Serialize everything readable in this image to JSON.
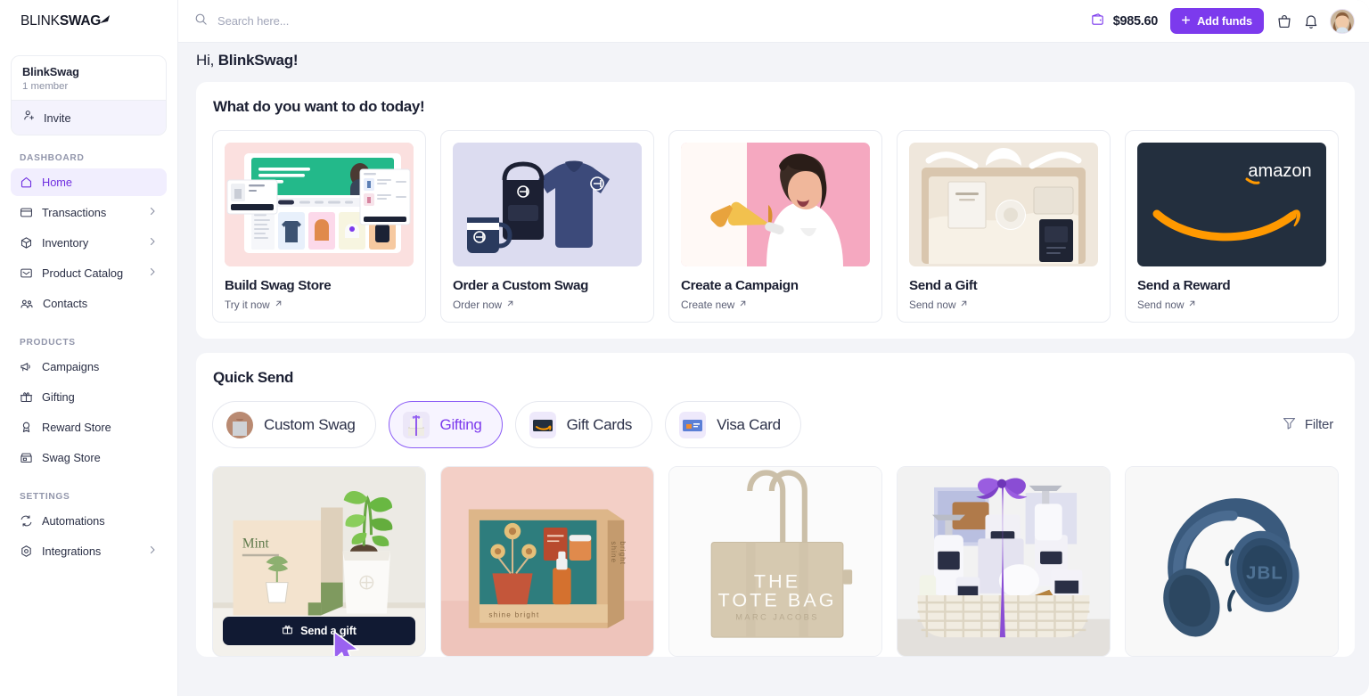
{
  "brand": {
    "name_light": "BLINK",
    "name_bold": "SWAG",
    "accent": "#7c3aed"
  },
  "topbar": {
    "search_placeholder": "Search here...",
    "search_value": "",
    "balance": "$985.60",
    "add_funds_label": "Add funds",
    "icons": [
      "wallet-icon",
      "bag-icon",
      "bell-icon",
      "avatar"
    ]
  },
  "sidebar": {
    "org": {
      "name": "BlinkSwag",
      "members": "1 member",
      "invite_label": "Invite"
    },
    "sections": [
      {
        "label": "DASHBOARD",
        "items": [
          {
            "label": "Home",
            "icon": "home-icon",
            "active": true,
            "chevron": false
          },
          {
            "label": "Transactions",
            "icon": "card-icon",
            "active": false,
            "chevron": true
          },
          {
            "label": "Inventory",
            "icon": "box-icon",
            "active": false,
            "chevron": true
          },
          {
            "label": "Product Catalog",
            "icon": "catalog-icon",
            "active": false,
            "chevron": true
          },
          {
            "label": "Contacts",
            "icon": "contacts-icon",
            "active": false,
            "chevron": false
          }
        ]
      },
      {
        "label": "PRODUCTS",
        "items": [
          {
            "label": "Campaigns",
            "icon": "megaphone-icon",
            "active": false,
            "chevron": false
          },
          {
            "label": "Gifting",
            "icon": "gift-icon",
            "active": false,
            "chevron": false
          },
          {
            "label": "Reward Store",
            "icon": "medal-icon",
            "active": false,
            "chevron": false
          },
          {
            "label": "Swag Store",
            "icon": "store-icon",
            "active": false,
            "chevron": false
          }
        ]
      },
      {
        "label": "SETTINGS",
        "items": [
          {
            "label": "Automations",
            "icon": "refresh-icon",
            "active": false,
            "chevron": false
          },
          {
            "label": "Integrations",
            "icon": "integrations-icon",
            "active": false,
            "chevron": true
          }
        ]
      }
    ]
  },
  "main": {
    "greeting_prefix": "Hi,",
    "greeting_name": "BlinkSwag!",
    "actions_panel_title": "What do you want to do today!",
    "actions": [
      {
        "title": "Build Swag Store",
        "link": "Try it now",
        "thumb": "swag-store-mockup",
        "mock_headline": "Bring your brand to life with your Swag Store."
      },
      {
        "title": "Order a Custom Swag",
        "link": "Order now",
        "thumb": "custom-swag-apparel"
      },
      {
        "title": "Create a Campaign",
        "link": "Create new",
        "thumb": "campaign-megaphone-woman"
      },
      {
        "title": "Send a Gift",
        "link": "Send now",
        "thumb": "gift-box-spa"
      },
      {
        "title": "Send a Reward",
        "link": "Send now",
        "thumb": "amazon-gift-card",
        "thumb_text": "amazon"
      }
    ],
    "quick_send": {
      "title": "Quick Send",
      "filter_label": "Filter",
      "tabs": [
        {
          "label": "Custom Swag",
          "icon": "tshirt-thumb",
          "active": false
        },
        {
          "label": "Gifting",
          "icon": "gift-basket-thumb",
          "active": true
        },
        {
          "label": "Gift Cards",
          "icon": "amazon-card-thumb",
          "active": false
        },
        {
          "label": "Visa Card",
          "icon": "visa-card-thumb",
          "active": false
        }
      ],
      "products": [
        {
          "name": "mint-grow-kit",
          "send_label": "Send a gift",
          "hovered": true
        },
        {
          "name": "shine-bright-gift-box",
          "hovered": false
        },
        {
          "name": "marc-jacobs-tote-bag",
          "hovered": false,
          "text1": "THE",
          "text2": "TOTE BAG",
          "text3": "MARC JACOBS"
        },
        {
          "name": "lavender-spa-basket",
          "hovered": false
        },
        {
          "name": "jbl-headphones",
          "hovered": false,
          "text1": "JBL"
        }
      ]
    }
  }
}
